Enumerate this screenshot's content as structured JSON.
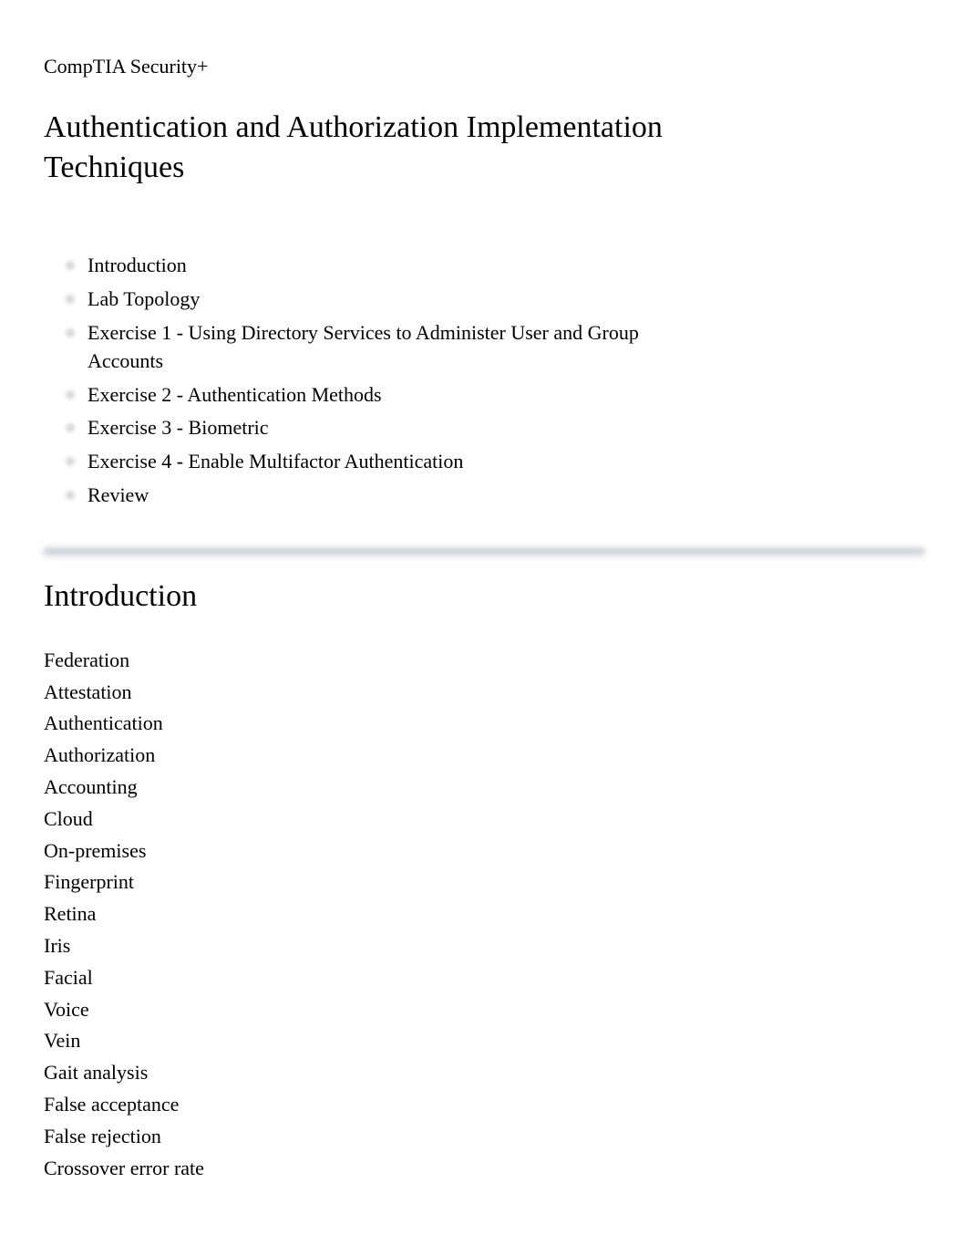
{
  "course_title": "CompTIA Security+",
  "main_title": "Authentication and Authorization Implementation Techniques",
  "toc": [
    "Introduction",
    "Lab Topology",
    "Exercise 1 - Using Directory Services to Administer User and Group Accounts",
    "Exercise 2 - Authentication Methods",
    "Exercise 3 - Biometric",
    "Exercise 4 - Enable Multifactor Authentication",
    "Review"
  ],
  "section_title": "Introduction",
  "terms": [
    "Federation",
    "Attestation",
    "Authentication",
    "Authorization",
    "Accounting",
    "Cloud",
    "On-premises",
    "Fingerprint",
    "Retina",
    "Iris",
    "Facial",
    "Voice",
    "Vein",
    "Gait analysis",
    "False acceptance",
    "False rejection",
    "Crossover error rate"
  ]
}
